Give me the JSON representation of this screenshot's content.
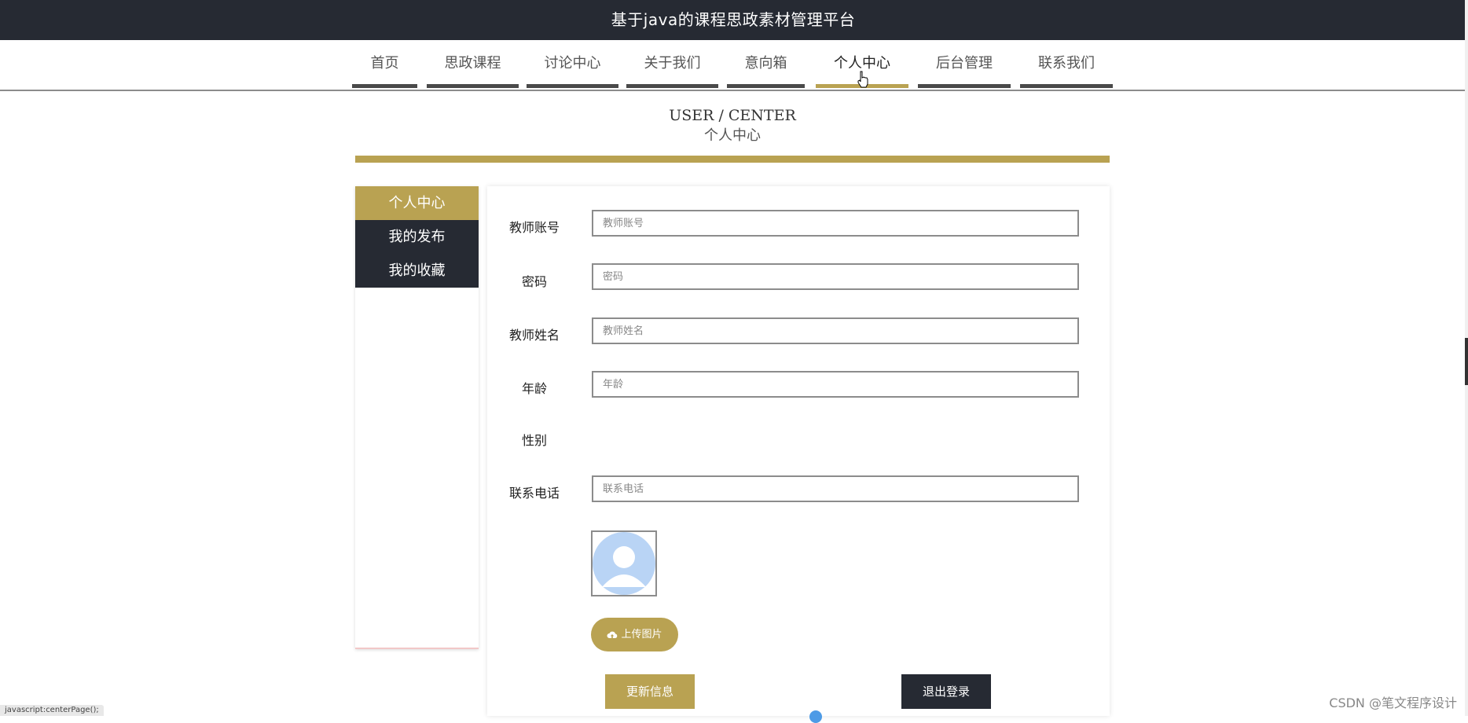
{
  "header": {
    "title": "基于java的课程思政素材管理平台"
  },
  "nav": {
    "items": [
      {
        "label": "首页"
      },
      {
        "label": "思政课程"
      },
      {
        "label": "讨论中心"
      },
      {
        "label": "关于我们"
      },
      {
        "label": "意向箱"
      },
      {
        "label": "个人中心"
      },
      {
        "label": "后台管理"
      },
      {
        "label": "联系我们"
      }
    ],
    "active": "个人中心"
  },
  "page_title": {
    "en": "USER / CENTER",
    "cn": "个人中心"
  },
  "sidebar": {
    "items": [
      {
        "label": "个人中心"
      },
      {
        "label": "我的发布"
      },
      {
        "label": "我的收藏"
      }
    ]
  },
  "form": {
    "account": {
      "label": "教师账号",
      "placeholder": "教师账号",
      "value": ""
    },
    "password": {
      "label": "密码",
      "placeholder": "密码",
      "value": ""
    },
    "name": {
      "label": "教师姓名",
      "placeholder": "教师姓名",
      "value": ""
    },
    "age": {
      "label": "年龄",
      "placeholder": "年龄",
      "value": ""
    },
    "gender": {
      "label": "性别"
    },
    "phone": {
      "label": "联系电话",
      "placeholder": "联系电话",
      "value": ""
    },
    "upload_label": "上传图片",
    "update_label": "更新信息",
    "logout_label": "退出登录"
  },
  "status": {
    "url": "javascript:centerPage();"
  },
  "watermark": "CSDN @笔文程序设计",
  "colors": {
    "header_bg": "#262a33",
    "accent": "#b9a252",
    "nav_underline": "#4a4a4a"
  },
  "icons": {
    "upload": "cloud-upload-icon",
    "avatar": "user-avatar-icon",
    "cursor": "hand-pointer-icon"
  }
}
